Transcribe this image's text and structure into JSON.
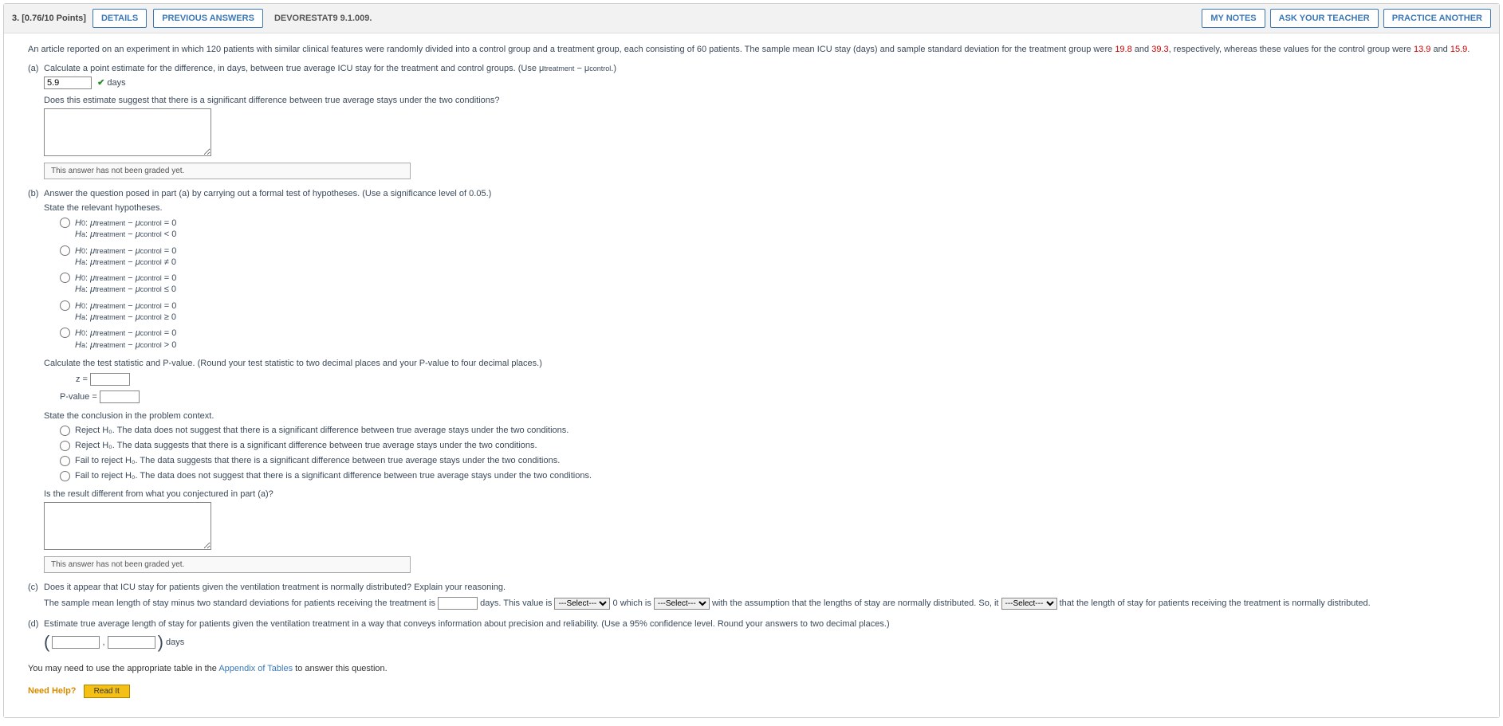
{
  "header": {
    "qnum": "3.",
    "points": "[0.76/10 Points]",
    "details": "DETAILS",
    "prev": "PREVIOUS ANSWERS",
    "source": "DEVORESTAT9 9.1.009.",
    "mynotes": "MY NOTES",
    "askteacher": "ASK YOUR TEACHER",
    "practice": "PRACTICE ANOTHER"
  },
  "stem": {
    "t1": "An article reported on an experiment in which 120 patients with similar clinical features were randomly divided into a control group and a treatment group, each consisting of 60 patients. The sample mean ICU stay (days) and sample standard deviation for the treatment group were ",
    "v1": "19.8",
    "t2": " and ",
    "v2": "39.3",
    "t3": ", respectively, whereas these values for the control group were ",
    "v3": "13.9",
    "t4": " and ",
    "v4": "15.9",
    "t5": "."
  },
  "a": {
    "q": "Calculate a point estimate for the difference, in days, between true average ICU stay for the treatment and control groups. (Use μ",
    "sub1": "treatment",
    "mid": " − μ",
    "sub2": "control",
    "end": ".)",
    "ans": "5.9",
    "days": "days",
    "follow": "Does this estimate suggest that there is a significant difference between true average stays under the two conditions?",
    "notgraded": "This answer has not been graded yet."
  },
  "b": {
    "q": "Answer the question posed in part (a) by carrying out a formal test of hypotheses. (Use a significance level of 0.05.)",
    "state": "State the relevant hypotheses.",
    "h": {
      "h0pre": "H",
      "h0sub": "0",
      "hasub": "a",
      "mu": "μ",
      "treat": "treatment",
      "control": "control",
      "eq0": " = 0",
      "lt0": " < 0",
      "ne0": " ≠ 0",
      "le0": " ≤ 0",
      "ge0": " ≥ 0",
      "gt0": " > 0"
    },
    "calc": "Calculate the test statistic and P-value. (Round your test statistic to two decimal places and your P-value to four decimal places.)",
    "zlab": "z =",
    "pvlab": "P-value =",
    "concl": "State the conclusion in the problem context.",
    "c1": "Reject H₀. The data does not suggest that there is a significant difference between true average stays under the two conditions.",
    "c2": "Reject H₀. The data suggests that there is a significant difference between true average stays under the two conditions.",
    "c3": "Fail to reject H₀. The data suggests that there is a significant difference between true average stays under the two conditions.",
    "c4": "Fail to reject H₀. The data does not suggest that there is a significant difference between true average stays under the two conditions.",
    "diff": "Is the result different from what you conjectured in part (a)?",
    "notgraded": "This answer has not been graded yet."
  },
  "c": {
    "q": "Does it appear that ICU stay for patients given the ventilation treatment is normally distributed? Explain your reasoning.",
    "t1": "The sample mean length of stay minus two standard deviations for patients receiving the treatment is ",
    "t2": " days. This value is ",
    "t3": " 0 which is ",
    "t4": " with the assumption that the lengths of stay are normally distributed. So, it ",
    "t5": " that the length of stay for patients receiving the treatment is normally distributed.",
    "sel": "---Select---"
  },
  "d": {
    "q": "Estimate true average length of stay for patients given the ventilation treatment in a way that conveys information about precision and reliability. (Use a 95% confidence level. Round your answers to two decimal places.)",
    "comma": " , ",
    "days": "days"
  },
  "foot": {
    "note1": "You may need to use the appropriate table in the ",
    "link": "Appendix of Tables",
    "note2": " to answer this question.",
    "need": "Need Help?",
    "readit": "Read It"
  }
}
